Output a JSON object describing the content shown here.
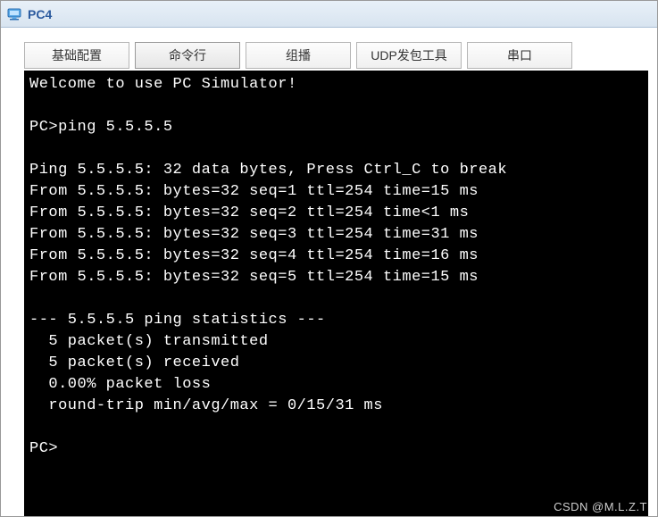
{
  "window": {
    "title": "PC4"
  },
  "tabs": [
    {
      "label": "基础配置",
      "active": false
    },
    {
      "label": "命令行",
      "active": true
    },
    {
      "label": "组播",
      "active": false
    },
    {
      "label": "UDP发包工具",
      "active": false
    },
    {
      "label": "串口",
      "active": false
    }
  ],
  "terminal": {
    "lines": [
      "Welcome to use PC Simulator!",
      "",
      "PC>ping 5.5.5.5",
      "",
      "Ping 5.5.5.5: 32 data bytes, Press Ctrl_C to break",
      "From 5.5.5.5: bytes=32 seq=1 ttl=254 time=15 ms",
      "From 5.5.5.5: bytes=32 seq=2 ttl=254 time<1 ms",
      "From 5.5.5.5: bytes=32 seq=3 ttl=254 time=31 ms",
      "From 5.5.5.5: bytes=32 seq=4 ttl=254 time=16 ms",
      "From 5.5.5.5: bytes=32 seq=5 ttl=254 time=15 ms",
      "",
      "--- 5.5.5.5 ping statistics ---",
      "  5 packet(s) transmitted",
      "  5 packet(s) received",
      "  0.00% packet loss",
      "  round-trip min/avg/max = 0/15/31 ms",
      "",
      "PC>"
    ]
  },
  "watermark": "CSDN @M.L.Z.T"
}
